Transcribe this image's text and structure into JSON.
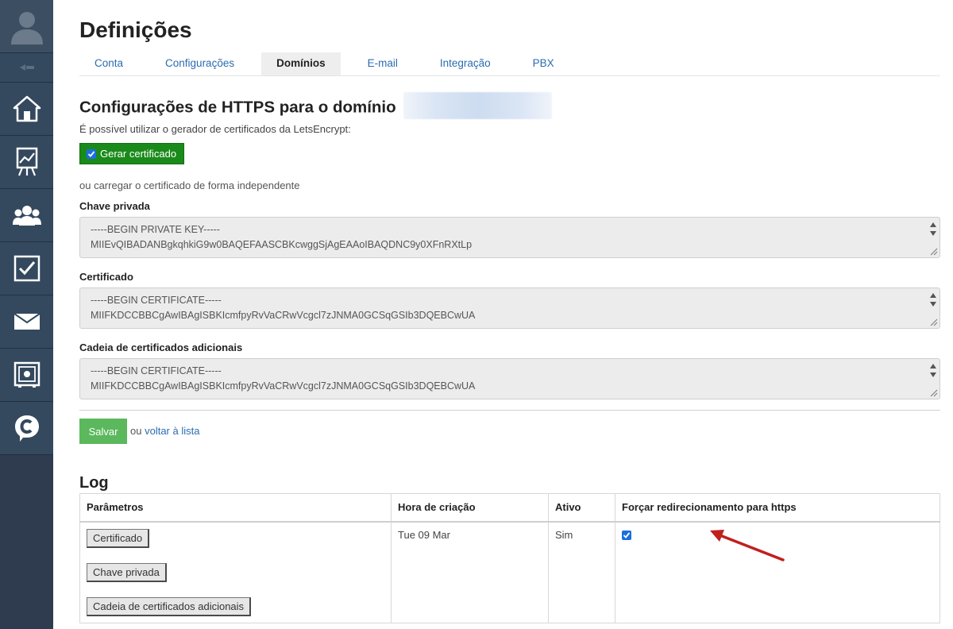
{
  "sidebar": {
    "items": [
      {
        "name": "user-avatar-icon"
      },
      {
        "name": "collapse-icon"
      },
      {
        "name": "home-icon"
      },
      {
        "name": "chart-board-icon"
      },
      {
        "name": "users-icon"
      },
      {
        "name": "task-check-icon"
      },
      {
        "name": "mail-icon"
      },
      {
        "name": "safe-icon"
      },
      {
        "name": "chat-c-icon"
      }
    ],
    "background": "#34495e"
  },
  "page": {
    "title": "Definições"
  },
  "tabs": [
    {
      "label": "Conta",
      "active": false
    },
    {
      "label": "Configurações",
      "active": false
    },
    {
      "label": "Domínios",
      "active": true
    },
    {
      "label": "E-mail",
      "active": false
    },
    {
      "label": "Integração",
      "active": false
    },
    {
      "label": "PBX",
      "active": false
    }
  ],
  "https": {
    "title": "Configurações de HTTPS para o domínio",
    "hint": "É possível utilizar o gerador de certificados da LetsEncrypt:",
    "generate_label": "Gerar certificado",
    "generate_checked": true,
    "or_text": "ou carregar o certificado de forma independente",
    "private_key": {
      "label": "Chave privada",
      "line1": "-----BEGIN PRIVATE KEY-----",
      "line2": "MIIEvQIBADANBgkqhkiG9w0BAQEFAASCBKcwggSjAgEAAoIBAQDNC9y0XFnRXtLp"
    },
    "certificate": {
      "label": "Certificado",
      "line1": "-----BEGIN CERTIFICATE-----",
      "line2": "MIIFKDCCBBCgAwIBAgISBKIcmfpyRvVaCRwVcgcl7zJNMA0GCSqGSIb3DQEBCwUA"
    },
    "chain": {
      "label": "Cadeia de certificados adicionais",
      "line1": "-----BEGIN CERTIFICATE-----",
      "line2": "MIIFKDCCBBCgAwIBAgISBKIcmfpyRvVaCRwVcgcl7zJNMA0GCSqGSIb3DQEBCwUA"
    },
    "save_label": "Salvar",
    "or_word": "ou",
    "back_label": "voltar à lista"
  },
  "log": {
    "title": "Log",
    "columns": [
      "Parâmetros",
      "Hora de criação",
      "Ativo",
      "Forçar redirecionamento para https"
    ],
    "row": {
      "buttons": [
        "Certificado",
        "Chave privada",
        "Cadeia de certificados adicionais"
      ],
      "created": "Tue 09 Mar",
      "active": "Sim",
      "force_https": true
    }
  },
  "colors": {
    "accent_link": "#2b6cb0",
    "green_button": "#1a8a1a",
    "save_button": "#5cb85c",
    "arrow": "#c0201e"
  }
}
